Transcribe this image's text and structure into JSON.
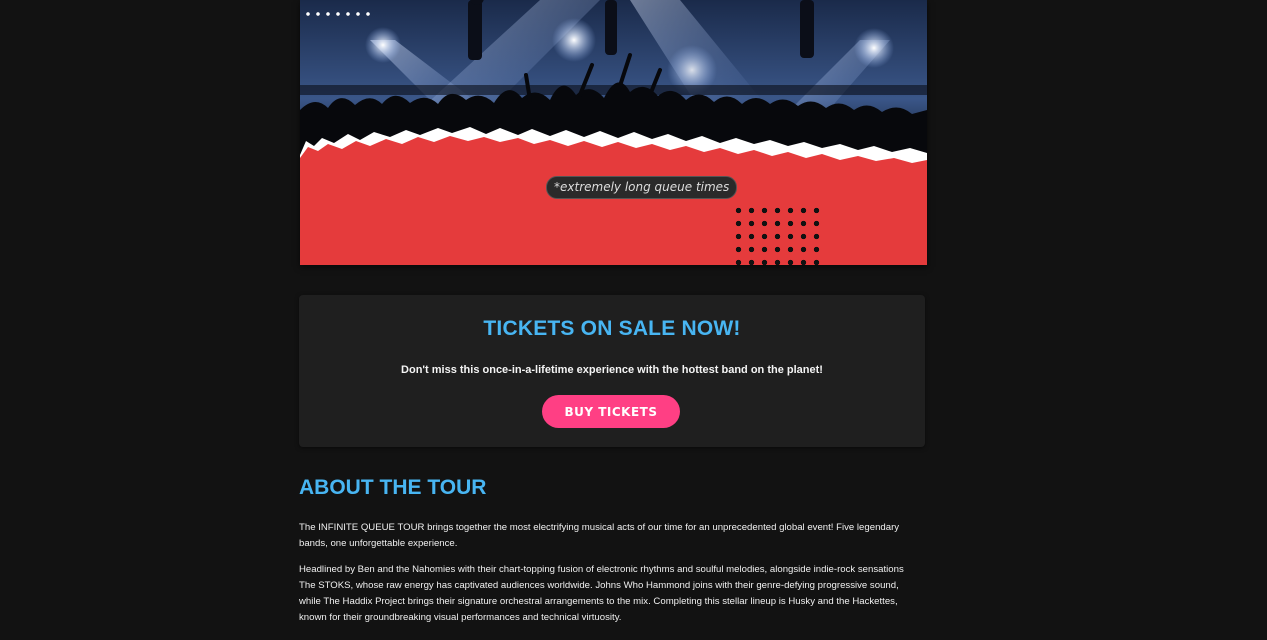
{
  "hero": {
    "badge_text": "*extremely long queue times",
    "photo_icon": "concert-crowd-image",
    "accent_color": "#e53b3c"
  },
  "tickets": {
    "heading": "TICKETS ON SALE NOW!",
    "description": "Don't miss this once-in-a-lifetime experience with the hottest band on the planet!",
    "button_label": "BUY TICKETS",
    "heading_color": "#48b5f2",
    "button_color": "#ff3f84"
  },
  "about": {
    "title": "ABOUT THE TOUR",
    "paragraphs": [
      "The INFINITE QUEUE TOUR brings together the most electrifying musical acts of our time for an unprecedented global event! Five legendary bands, one unforgettable experience.",
      "Headlined by Ben and the Nahomies with their chart-topping fusion of electronic rhythms and soulful melodies, alongside indie-rock sensations The STOKS, whose raw energy has captivated audiences worldwide. Johns Who Hammond joins with their genre-defying progressive sound, while The Haddix Project brings their signature orchestral arrangements to the mix. Completing this stellar lineup is Husky and the Hackettes, known for their groundbreaking visual performances and technical virtuosity."
    ]
  }
}
